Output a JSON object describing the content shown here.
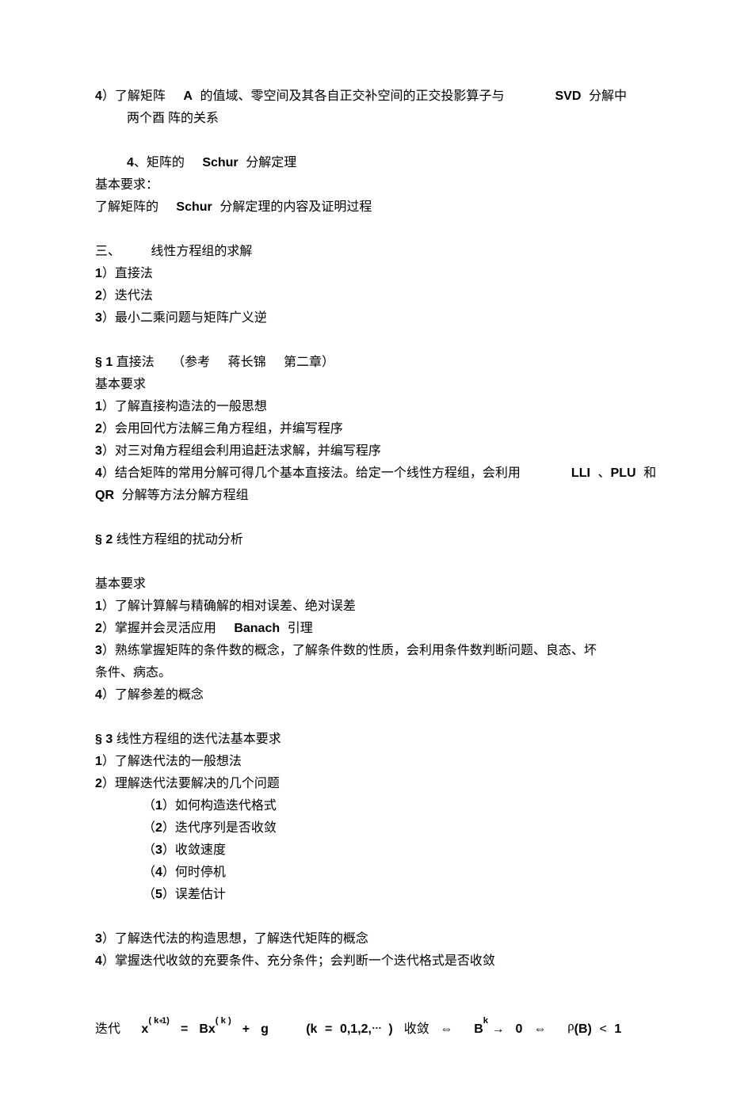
{
  "p01a": "4",
  "p01b": "）了解矩阵",
  "p01c": "A",
  "p01d": "的值域、零空间及其各自正交补空间的正交投影算子与",
  "p01e": "SVD",
  "p01f": "分解中两个酉",
  "p02": "阵的关系",
  "p03a": "4",
  "p03b": "、矩阵的",
  "p03c": "Schur",
  "p03d": "分解定理",
  "p04": "基本要求：",
  "p05a": "了解矩阵的",
  "p05b": "Schur",
  "p05c": "分解定理的内容及证明过程",
  "p06": "三、",
  "p06b": "线性方程组的求解",
  "p07a": "1",
  "p07b": "）直接法",
  "p08a": "2",
  "p08b": "）迭代法",
  "p09a": "3",
  "p09b": "）最小二乘问题与矩阵广义逆",
  "p10a": "§1",
  "p10b": "直接法",
  "p10c": "（参考",
  "p10d": "蒋长锦",
  "p10e": "第二章）",
  "p11": "基本要求",
  "p12a": "1",
  "p12b": "）了解直接构造法的一般思想",
  "p13a": "2",
  "p13b": "）会用回代方法解三角方程组，并编写程序",
  "p14a": "3",
  "p14b": "）对三对角方程组会利用追赶法求解，并编写程序",
  "p15a": "4",
  "p15b": "）结合矩阵的常用分解可得几个基本直接法。给定一个线性方程组，会利用",
  "p15c": "LLI",
  "p15d": "、",
  "p15e": "PLU",
  "p15f": "和",
  "p16a": "QR",
  "p16b": "分解等方法分解方程组",
  "p17a": "§2",
  "p17b": "线性方程组的扰动分析",
  "p18": "基本要求",
  "p19a": "1",
  "p19b": "）了解计算解与精确解的相对误差、绝对误差",
  "p20a": "2",
  "p20b": "）掌握并会灵活应用",
  "p20c": "Banach",
  "p20d": "引理",
  "p21a": "3",
  "p21b": "）熟练掌握矩阵的条件数的概念，了解条件数的性质，会利用条件数判断问题、良态、坏",
  "p22": "条件、病态。",
  "p23a": "4",
  "p23b": "）了解参差的概念",
  "p24a": "§3",
  "p24b": "线性方程组的迭代法基本要求",
  "p25a": "1",
  "p25b": "）了解迭代法的一般想法",
  "p26a": "2",
  "p26b": "）理解迭代法要解决的几个问题",
  "p27a": "（",
  "p27b": "1",
  "p27c": "）如何构造迭代格式",
  "p28a": "（",
  "p28b": "2",
  "p28c": "）迭代序列是否收敛",
  "p29a": "（",
  "p29b": "3",
  "p29c": "）收敛速度",
  "p30a": "（",
  "p30b": "4",
  "p30c": "）何时停机",
  "p31a": "（",
  "p31b": "5",
  "p31c": "）误差估计",
  "p32a": "3",
  "p32b": "）了解迭代法的构造思想，了解迭代矩阵的概念",
  "p33a": "4",
  "p33b": "）掌握迭代收敛的充要条件、充分条件；会判断一个迭代格式是否收敛",
  "p34a": "迭代",
  "f": {
    "x1": "x",
    "k11": "( k",
    "k12": "1)",
    "eq1": "=",
    "B1": "Bx",
    "kk": "( k )",
    "plus": "+",
    "g": "g",
    "lp": "(k",
    "eq2": "=",
    "seq": "0,1,2,",
    "dots": "…",
    "rp": ")",
    "conv": "收敛",
    "iff1": "⇔",
    "Bk": "B",
    "kexp": "k",
    "arrow": "→",
    "zero": "0",
    "iff2": "⇔",
    "rho": "ρ",
    "lpar": "(B)",
    "lt": "<",
    "one": "1"
  }
}
